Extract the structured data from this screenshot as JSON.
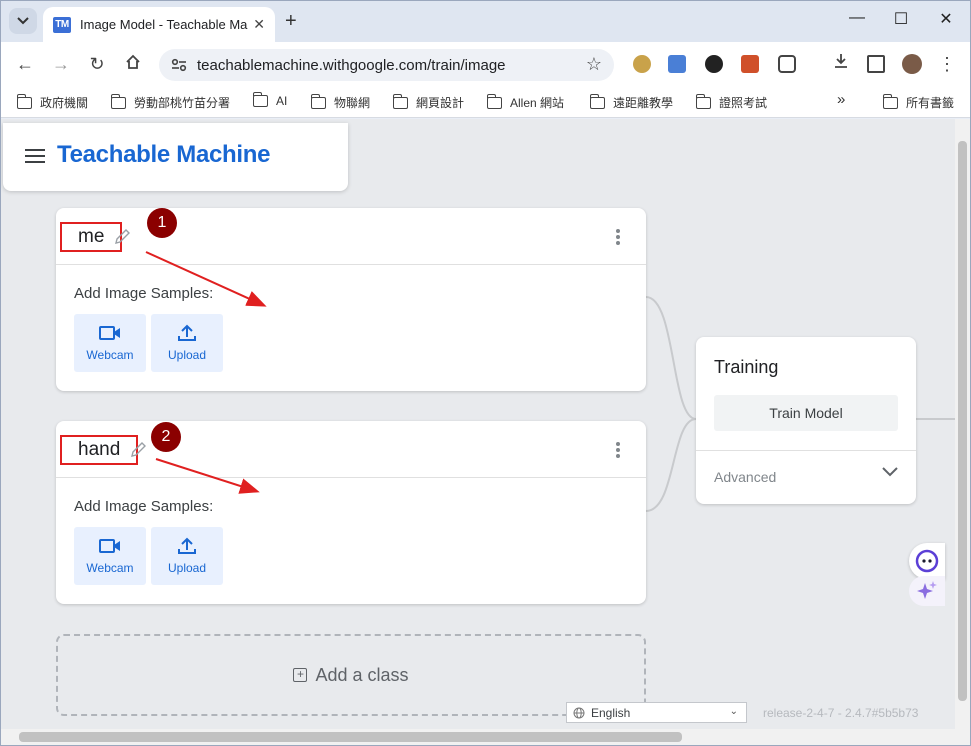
{
  "browser": {
    "tab_title": "Image Model - Teachable Ma",
    "favicon_text": "TM",
    "url": "teachablemachine.withgoogle.com/train/image",
    "bookmarks": [
      "政府機關",
      "勞動部桃竹苗分署",
      "AI",
      "物聯網",
      "網頁設計",
      "Allen 網站",
      "遠距離教學",
      "證照考試"
    ],
    "bookmarks_overflow": "»",
    "all_bookmarks": "所有書籤"
  },
  "app": {
    "title": "Teachable Machine",
    "classes": [
      {
        "name": "me",
        "samples_label": "Add Image Samples:",
        "webcam_label": "Webcam",
        "upload_label": "Upload",
        "annotation": "1"
      },
      {
        "name": "hand",
        "samples_label": "Add Image Samples:",
        "webcam_label": "Webcam",
        "upload_label": "Upload",
        "annotation": "2"
      }
    ],
    "add_class_label": "Add a class",
    "training": {
      "title": "Training",
      "button": "Train Model",
      "advanced": "Advanced"
    },
    "language": "English",
    "release": "release-2-4-7 - 2.4.7#5b5b73"
  },
  "colors": {
    "brand_blue": "#1967d2",
    "annotation_red": "#e02020",
    "badge_dark_red": "#8b0000"
  }
}
